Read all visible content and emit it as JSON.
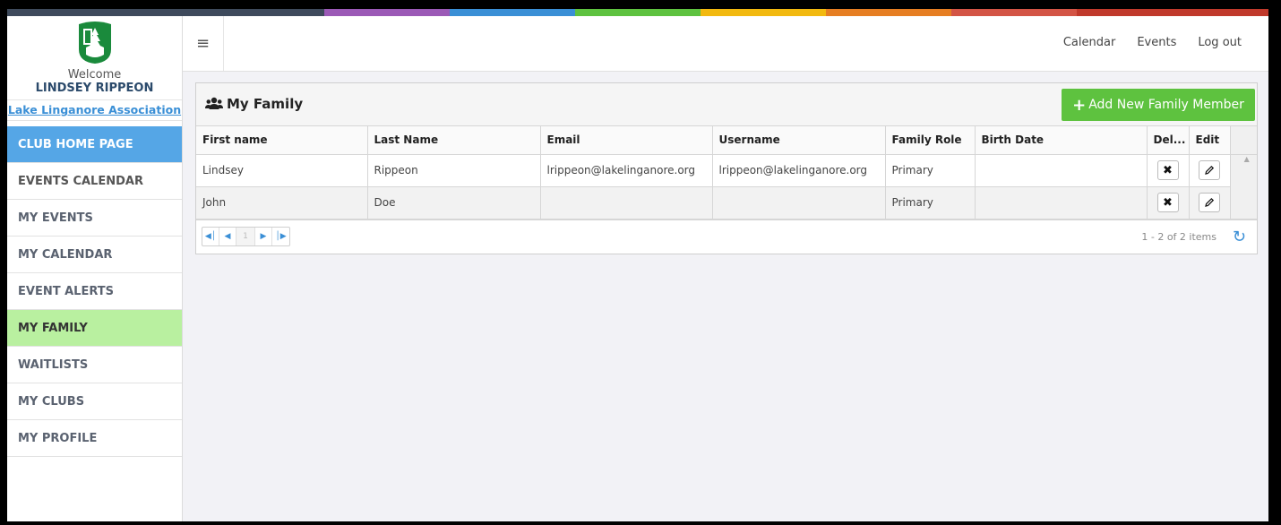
{
  "colors": {
    "strip": [
      "#3e4a5c",
      "#9b59b6",
      "#3a8fd6",
      "#5ec23f",
      "#f2b90f",
      "#e67e22",
      "#d35445",
      "#c0392b"
    ],
    "accent_green": "#5ec23f",
    "nav_active": "#b9f0a0",
    "nav_home": "#55a6e6"
  },
  "sidebar": {
    "welcome": "Welcome",
    "user_name": "LINDSEY RIPPEON",
    "club_link": "Lake Linganore Association",
    "items": [
      {
        "label": "CLUB HOME PAGE",
        "state": "home"
      },
      {
        "label": "EVENTS CALENDAR",
        "state": "normal"
      },
      {
        "label": "MY EVENTS",
        "state": "normal"
      },
      {
        "label": "MY CALENDAR",
        "state": "normal"
      },
      {
        "label": "EVENT ALERTS",
        "state": "normal"
      },
      {
        "label": "MY FAMILY",
        "state": "active"
      },
      {
        "label": "WAITLISTS",
        "state": "normal"
      },
      {
        "label": "MY CLUBS",
        "state": "normal"
      },
      {
        "label": "MY PROFILE",
        "state": "normal"
      }
    ]
  },
  "topbar": {
    "menu_icon": "hamburger-icon",
    "links": [
      "Calendar",
      "Events",
      "Log out"
    ]
  },
  "panel": {
    "title": "My Family",
    "title_icon": "users-icon",
    "add_button": "Add New Family Member"
  },
  "table": {
    "columns": [
      "First name",
      "Last Name",
      "Email",
      "Username",
      "Family Role",
      "Birth Date",
      "Del...",
      "Edit"
    ],
    "rows": [
      {
        "first": "Lindsey",
        "last": "Rippeon",
        "email": "lrippeon@lakelinganore.org",
        "username": "lrippeon@lakelinganore.org",
        "role": "Primary",
        "birth": ""
      },
      {
        "first": "John",
        "last": "Doe",
        "email": "",
        "username": "",
        "role": "Primary",
        "birth": ""
      }
    ]
  },
  "pager": {
    "current_page": "1",
    "info": "1 - 2 of 2 items"
  }
}
